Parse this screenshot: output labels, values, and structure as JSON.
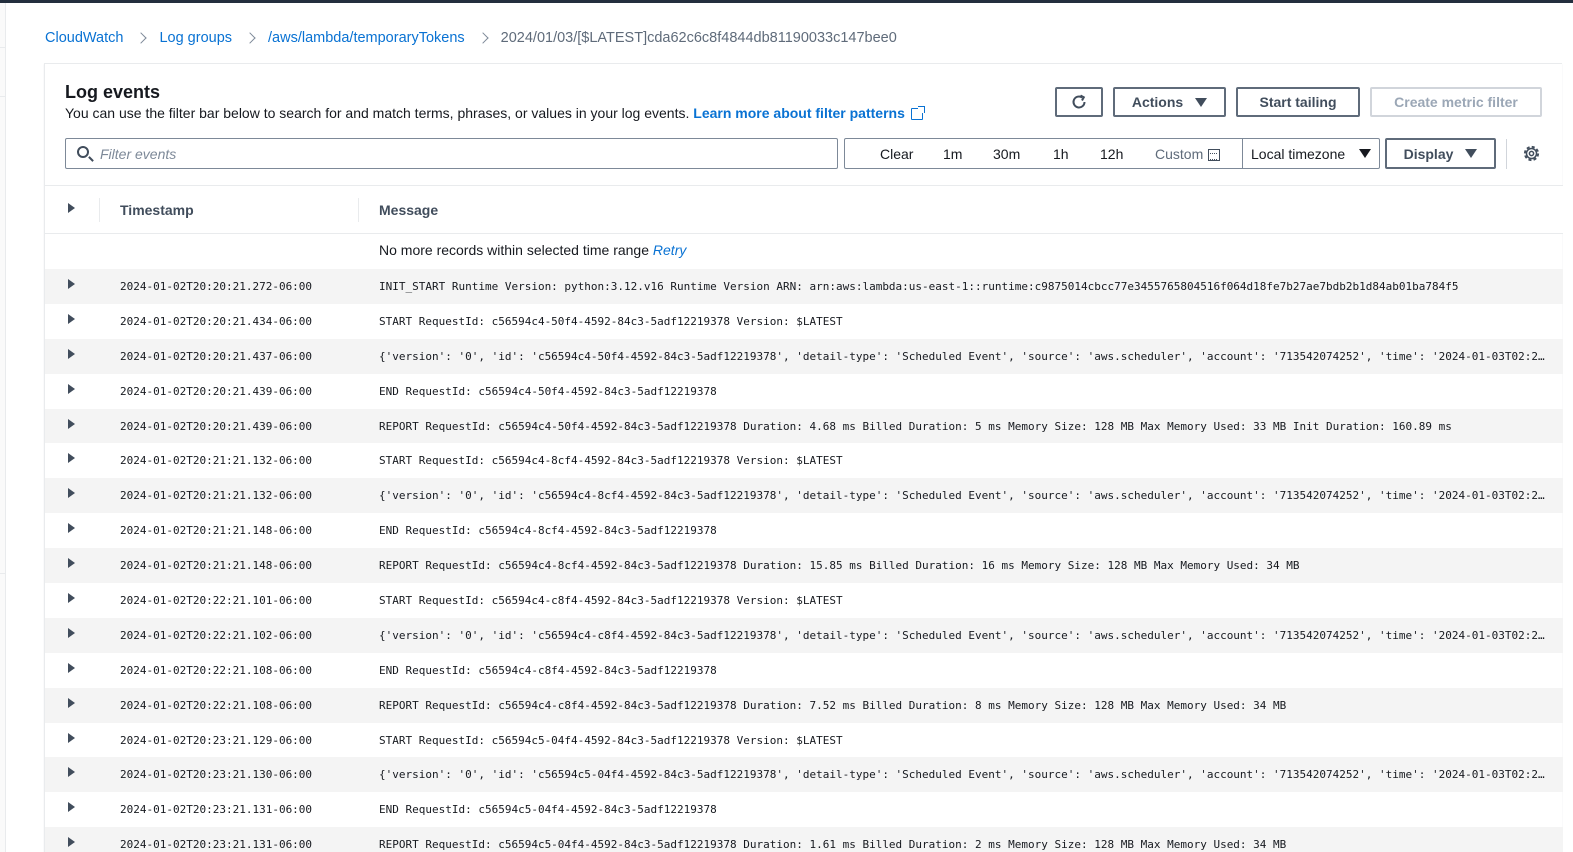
{
  "breadcrumb": {
    "items": [
      "CloudWatch",
      "Log groups",
      "/aws/lambda/temporaryTokens"
    ],
    "current": "2024/01/03/[$LATEST]cda62c6c8f4844db81190033c147bee0"
  },
  "header": {
    "title": "Log events",
    "description": "You can use the filter bar below to search for and match terms, phrases, or values in your log events.",
    "learn_more": "Learn more about filter patterns"
  },
  "toolbar": {
    "refresh_icon": "refresh-icon",
    "actions_label": "Actions",
    "start_tailing_label": "Start tailing",
    "create_metric_filter_label": "Create metric filter"
  },
  "filter": {
    "placeholder": "Filter events",
    "value": ""
  },
  "range": {
    "clear": "Clear",
    "options": [
      "1m",
      "30m",
      "1h",
      "12h"
    ],
    "custom": "Custom",
    "timezone": "Local timezone",
    "display": "Display"
  },
  "table": {
    "headers": [
      "Timestamp",
      "Message"
    ],
    "no_records": "No more records within selected time range",
    "retry": "Retry",
    "rows": [
      {
        "ts": "2024-01-02T20:20:21.272-06:00",
        "msg": "INIT_START Runtime Version: python:3.12.v16 Runtime Version ARN: arn:aws:lambda:us-east-1::runtime:c9875014cbcc77e3455765804516f064d18fe7b27ae7bdb2b1d84ab01ba784f5"
      },
      {
        "ts": "2024-01-02T20:20:21.434-06:00",
        "msg": "START RequestId: c56594c4-50f4-4592-84c3-5adf12219378 Version: $LATEST"
      },
      {
        "ts": "2024-01-02T20:20:21.437-06:00",
        "msg": "{'version': '0', 'id': 'c56594c4-50f4-4592-84c3-5adf12219378', 'detail-type': 'Scheduled Event', 'source': 'aws.scheduler', 'account': '713542074252', 'time': '2024-01-03T02:20…"
      },
      {
        "ts": "2024-01-02T20:20:21.439-06:00",
        "msg": "END RequestId: c56594c4-50f4-4592-84c3-5adf12219378"
      },
      {
        "ts": "2024-01-02T20:20:21.439-06:00",
        "msg": "REPORT RequestId: c56594c4-50f4-4592-84c3-5adf12219378 Duration: 4.68 ms Billed Duration: 5 ms Memory Size: 128 MB Max Memory Used: 33 MB Init Duration: 160.89 ms"
      },
      {
        "ts": "2024-01-02T20:21:21.132-06:00",
        "msg": "START RequestId: c56594c4-8cf4-4592-84c3-5adf12219378 Version: $LATEST"
      },
      {
        "ts": "2024-01-02T20:21:21.132-06:00",
        "msg": "{'version': '0', 'id': 'c56594c4-8cf4-4592-84c3-5adf12219378', 'detail-type': 'Scheduled Event', 'source': 'aws.scheduler', 'account': '713542074252', 'time': '2024-01-03T02:21…"
      },
      {
        "ts": "2024-01-02T20:21:21.148-06:00",
        "msg": "END RequestId: c56594c4-8cf4-4592-84c3-5adf12219378"
      },
      {
        "ts": "2024-01-02T20:21:21.148-06:00",
        "msg": "REPORT RequestId: c56594c4-8cf4-4592-84c3-5adf12219378 Duration: 15.85 ms Billed Duration: 16 ms Memory Size: 128 MB Max Memory Used: 34 MB"
      },
      {
        "ts": "2024-01-02T20:22:21.101-06:00",
        "msg": "START RequestId: c56594c4-c8f4-4592-84c3-5adf12219378 Version: $LATEST"
      },
      {
        "ts": "2024-01-02T20:22:21.102-06:00",
        "msg": "{'version': '0', 'id': 'c56594c4-c8f4-4592-84c3-5adf12219378', 'detail-type': 'Scheduled Event', 'source': 'aws.scheduler', 'account': '713542074252', 'time': '2024-01-03T02:22…"
      },
      {
        "ts": "2024-01-02T20:22:21.108-06:00",
        "msg": "END RequestId: c56594c4-c8f4-4592-84c3-5adf12219378"
      },
      {
        "ts": "2024-01-02T20:22:21.108-06:00",
        "msg": "REPORT RequestId: c56594c4-c8f4-4592-84c3-5adf12219378 Duration: 7.52 ms Billed Duration: 8 ms Memory Size: 128 MB Max Memory Used: 34 MB"
      },
      {
        "ts": "2024-01-02T20:23:21.129-06:00",
        "msg": "START RequestId: c56594c5-04f4-4592-84c3-5adf12219378 Version: $LATEST"
      },
      {
        "ts": "2024-01-02T20:23:21.130-06:00",
        "msg": "{'version': '0', 'id': 'c56594c5-04f4-4592-84c3-5adf12219378', 'detail-type': 'Scheduled Event', 'source': 'aws.scheduler', 'account': '713542074252', 'time': '2024-01-03T02:23…"
      },
      {
        "ts": "2024-01-02T20:23:21.131-06:00",
        "msg": "END RequestId: c56594c5-04f4-4592-84c3-5adf12219378"
      },
      {
        "ts": "2024-01-02T20:23:21.131-06:00",
        "msg": "REPORT RequestId: c56594c5-04f4-4592-84c3-5adf12219378 Duration: 1.61 ms Billed Duration: 2 ms Memory Size: 128 MB Max Memory Used: 34 MB"
      }
    ]
  },
  "colors": {
    "link": "#0972d3",
    "text": "#16191f",
    "border": "#7d8998",
    "row_alt": "#f4f4f4"
  }
}
